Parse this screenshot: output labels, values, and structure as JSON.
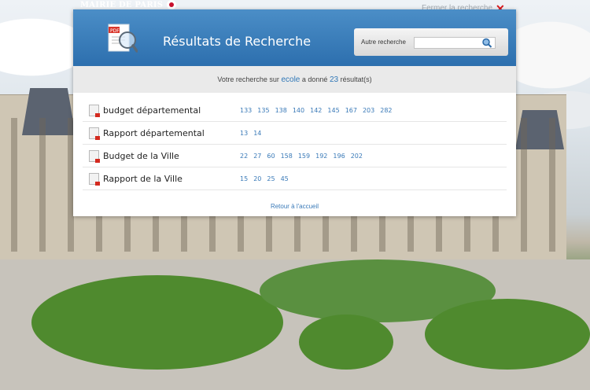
{
  "brand": {
    "logo_text": "MAIRIE DE PARIS"
  },
  "close": {
    "label": "Fermer la recherche"
  },
  "header": {
    "title": "Résultats de Recherche"
  },
  "search": {
    "label": "Autre recherche",
    "value": "",
    "placeholder": ""
  },
  "summary": {
    "prefix": "Votre recherche sur",
    "term": "ecole",
    "middle": "a donné",
    "count": "23",
    "suffix": "résultat(s)"
  },
  "results": [
    {
      "title": "budget départemental",
      "pages": [
        "133",
        "135",
        "138",
        "140",
        "142",
        "145",
        "167",
        "203",
        "282"
      ]
    },
    {
      "title": "Rapport départemental",
      "pages": [
        "13",
        "14"
      ]
    },
    {
      "title": "Budget de la Ville",
      "pages": [
        "22",
        "27",
        "60",
        "158",
        "159",
        "192",
        "196",
        "202"
      ]
    },
    {
      "title": "Rapport de la Ville",
      "pages": [
        "15",
        "20",
        "25",
        "45"
      ]
    }
  ],
  "footer": {
    "home_link": "Retour à l'accueil"
  },
  "colors": {
    "header_blue": "#2d6fae",
    "link_blue": "#3a7ab8",
    "close_red": "#d8171c"
  },
  "icons": [
    "logo-icon",
    "close-icon",
    "document-search-icon",
    "magnifier-icon",
    "pdf-icon"
  ]
}
